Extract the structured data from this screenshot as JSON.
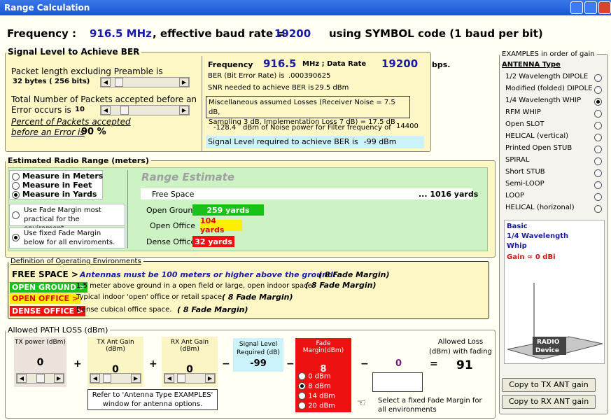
{
  "window": {
    "title": "Range Calculation"
  },
  "header": {
    "frequency_label": "Frequency   :",
    "frequency_value": "916.5 MHz",
    "baud_label": ", effective baud rate =",
    "baud_value": "19200",
    "symbol_text": "using SYMBOL code (1 baud per bit)"
  },
  "signal_level": {
    "legend": "Signal Level to Achieve BER",
    "packet_length_label": "Packet length  excluding Preamble is",
    "packet_length_value": "32 bytes ( 256 bits)",
    "total_packets_label": "Total Number of Packets accepted before an",
    "error_occurs_label": "Error  occurs is",
    "error_occurs_value": "10",
    "percent_label_1": "Percent of Packets accepted",
    "percent_label_2": "before an Error is",
    "percent_value": "90 %",
    "frequency_label": "Frequency",
    "frequency_value": "916.5",
    "mhz_data_rate": "MHz ;  Data Rate",
    "data_rate_value": "19200",
    "bps": "bps.",
    "ber_label": "BER (Bit Error Rate)  is",
    "ber_value": ".000390625",
    "snr_label": "SNR needed to achieve BER is",
    "snr_value": "29.5 dBm",
    "misc_losses_1": "Miscellaneous assumed Losses (Receiver Noise = 7.5 dB,",
    "misc_losses_2": "Sampling 3 dB, Implementation Loss 7 dB) =  17.5 dB",
    "noise_value": "-128.4",
    "noise_label": "dBm of Noise power for Filter frequency of",
    "filter_value": "14400",
    "required_label": "Signal Level required to achieve BER is",
    "required_value": "-99 dBm"
  },
  "range": {
    "legend": "Estimated Radio Range (meters)",
    "units": [
      {
        "label": "Measure in Meters",
        "selected": false
      },
      {
        "label": "Measure in Feet",
        "selected": false
      },
      {
        "label": "Measure in Yards",
        "selected": true
      }
    ],
    "fade_option_1": "Use  Fade Margin most practical for the enviroment.",
    "fade_option_2": "Use fixed Fade Margin below for all enviroments.",
    "estimate_title": "Range Estimate",
    "free_space_label": "Free Space",
    "free_space_value": "...  1016  yards",
    "open_ground_label": "Open Ground",
    "open_ground_value": "259  yards",
    "open_office_label": "Open Office",
    "open_office_value": "104  yards",
    "dense_office_label": "Dense Office",
    "dense_office_value": "32  yards",
    "levels": {
      "free_space": 1016,
      "open_ground": 259,
      "open_office": 104,
      "dense_office": 32
    },
    "colors": {
      "open_ground": "#19c219",
      "open_office": "#ffee00",
      "dense_office": "#ee1111"
    }
  },
  "definitions": {
    "legend": "Definition of Operating Environments",
    "free_space_tag": "FREE SPACE  >",
    "free_space_text": "Antennas  must be 100 meters or higher above the ground!",
    "free_space_margin": "( 8 Fade Margin)",
    "open_ground_tag": "OPEN GROUND >",
    "open_ground_text": "1.5 meter above ground in a open field or large, open indoor space.",
    "open_ground_margin": "( 8 Fade Margin)",
    "open_office_tag": "OPEN OFFICE  >",
    "open_office_text": "Typical indoor 'open' office or retail space.",
    "open_office_margin": "( 8 Fade Margin)",
    "dense_office_tag": "DENSE OFFICE >",
    "dense_office_text": "Dense cubical office space.",
    "dense_office_margin": "( 8 Fade Margin)"
  },
  "path_loss": {
    "legend": "Allowed PATH LOSS (dBm)",
    "tx_power_label": "TX power (dBm)",
    "tx_power_value": "0",
    "tx_gain_label": "TX Ant Gain (dBm)",
    "tx_gain_value": "0",
    "rx_gain_label": "RX Ant Gain (dBm)",
    "rx_gain_value": "0",
    "signal_label": "Signal Level Required (dB)",
    "signal_value": "-99",
    "fade_label": "Fade Margin(dBm)",
    "fade_value": "8",
    "fade_options": [
      {
        "label": "0 dBm",
        "selected": false
      },
      {
        "label": "8 dBm",
        "selected": true
      },
      {
        "label": "14 dBm",
        "selected": false
      },
      {
        "label": "20 dBm",
        "selected": false
      }
    ],
    "extra_value": "0",
    "allowed_label": "Allowed Loss (dBm) with fading",
    "allowed_value": "91",
    "plus": "+",
    "minus": "−",
    "equals": "=",
    "refer_note": "Refer to 'Antenna Type EXAMPLES' window  for antenna options.",
    "select_note": "Select a fixed Fade Margin for  all environments"
  },
  "examples": {
    "legend": "EXAMPLES in order of gain",
    "heading": "ANTENNA Type",
    "items": [
      {
        "label": "1/2 Wavelength DIPOLE",
        "selected": false
      },
      {
        "label": "Modified (folded) DIPOLE",
        "selected": false
      },
      {
        "label": "1/4 Wavelength WHIP",
        "selected": true
      },
      {
        "label": "RFM WHIP",
        "selected": false
      },
      {
        "label": "Open SLOT",
        "selected": false
      },
      {
        "label": "HELICAL  (vertical)",
        "selected": false
      },
      {
        "label": "Printed Open STUB",
        "selected": false
      },
      {
        "label": "SPIRAL",
        "selected": false
      },
      {
        "label": "Short STUB",
        "selected": false
      },
      {
        "label": "Semi-LOOP",
        "selected": false
      },
      {
        "label": "LOOP",
        "selected": false
      },
      {
        "label": "HELICAL (horizonal)",
        "selected": false
      }
    ],
    "detail_line1": "Basic",
    "detail_line2": "1/4 Wavelength",
    "detail_line3": "Whip",
    "gain_text": "Gain ≈ 0 dBi",
    "device_label_1": "RADIO",
    "device_label_2": "Device",
    "copy_tx": "Copy to TX ANT gain",
    "copy_rx": "Copy to RX ANT gain"
  }
}
